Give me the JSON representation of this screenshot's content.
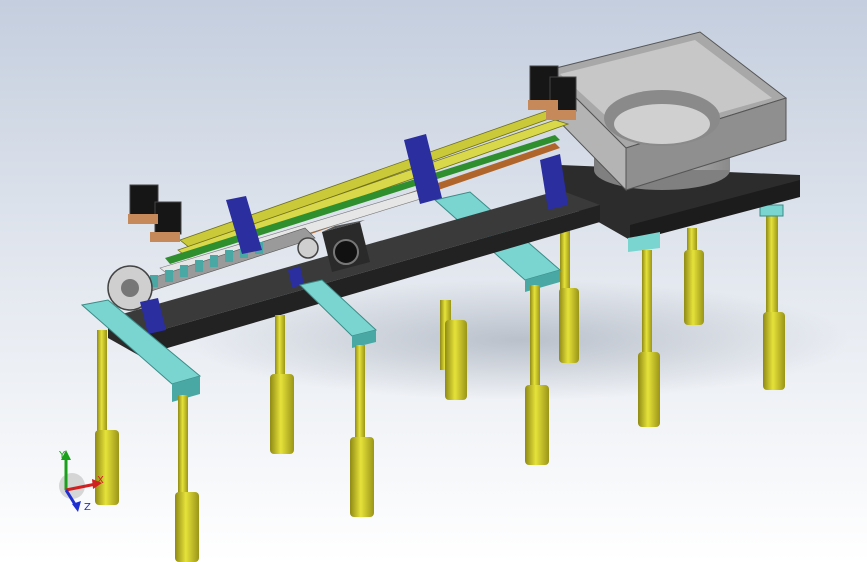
{
  "viewport": {
    "background_top": "#c4cede",
    "background_bottom": "#ffffff"
  },
  "model": {
    "components": [
      "base-plate",
      "support-legs",
      "cross-beams",
      "rail-assembly",
      "blue-brackets",
      "stepper-motors",
      "gearbox-motor",
      "feeder-platform",
      "vibratory-bowl"
    ],
    "colors": {
      "legs": "#d4d22a",
      "legs_dark": "#8f8a14",
      "cross_beams": "#7ad4d0",
      "base_plate": "#3a3a3a",
      "rails": "#c9c93a",
      "green_rail": "#2f8f2f",
      "brackets": "#2a2e9e",
      "motors": "#161616",
      "bowl": "#9c9c9c",
      "feeder_platform": "#2c2c2c"
    }
  },
  "triad": {
    "y_label": "Y",
    "x_label": "X",
    "z_label": "Z",
    "y_color": "#1aa01a",
    "x_color": "#d02020",
    "z_color": "#2030d0"
  }
}
